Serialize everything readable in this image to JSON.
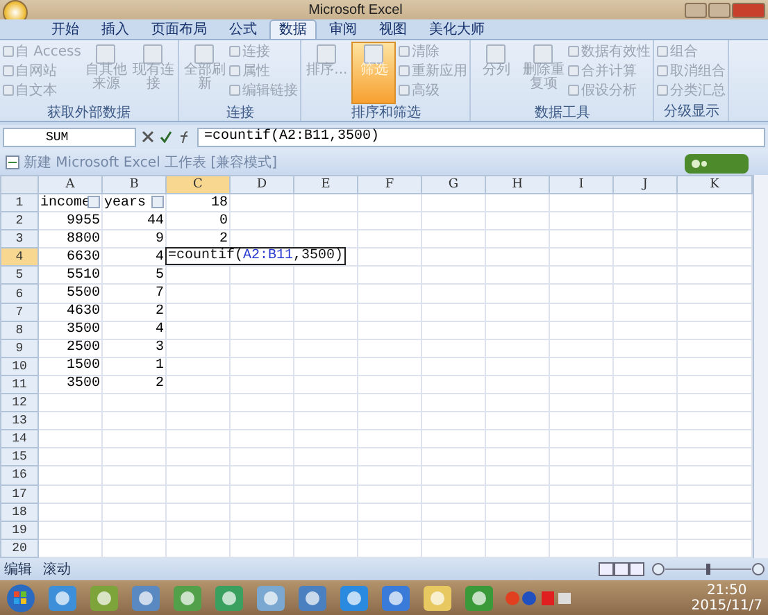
{
  "window": {
    "title": "Microsoft Excel"
  },
  "tabs": [
    {
      "label": "开始",
      "selected": false
    },
    {
      "label": "插入",
      "selected": false
    },
    {
      "label": "页面布局",
      "selected": false
    },
    {
      "label": "公式",
      "selected": false
    },
    {
      "label": "数据",
      "selected": true
    },
    {
      "label": "审阅",
      "selected": false
    },
    {
      "label": "视图",
      "selected": false
    },
    {
      "label": "美化大师",
      "selected": false
    }
  ],
  "ribbon": {
    "groups": [
      {
        "title": "获取外部数据",
        "columns": [
          [
            {
              "label": "自 Access",
              "kind": "small",
              "disabled": true,
              "active": false
            },
            {
              "label": "自网站",
              "kind": "small",
              "disabled": true,
              "active": false
            },
            {
              "label": "自文本",
              "kind": "small",
              "disabled": true,
              "active": false
            }
          ],
          [
            {
              "label": "自其他来源",
              "kind": "large",
              "disabled": true,
              "active": false
            }
          ],
          [
            {
              "label": "现有连接",
              "kind": "large",
              "disabled": true,
              "active": false
            }
          ]
        ]
      },
      {
        "title": "连接",
        "columns": [
          [
            {
              "label": "全部刷新",
              "kind": "large",
              "disabled": true,
              "active": false
            }
          ],
          [
            {
              "label": "连接",
              "kind": "small",
              "disabled": true,
              "active": false
            },
            {
              "label": "属性",
              "kind": "small",
              "disabled": true,
              "active": false
            },
            {
              "label": "编辑链接",
              "kind": "small",
              "disabled": true,
              "active": false
            }
          ]
        ]
      },
      {
        "title": "排序和筛选",
        "columns": [
          [
            {
              "label": "排序...",
              "kind": "large",
              "disabled": true,
              "active": false
            }
          ],
          [
            {
              "label": "筛选",
              "kind": "large",
              "disabled": true,
              "active": true
            }
          ],
          [
            {
              "label": "清除",
              "kind": "small",
              "disabled": true,
              "active": false
            },
            {
              "label": "重新应用",
              "kind": "small",
              "disabled": true,
              "active": false
            },
            {
              "label": "高级",
              "kind": "small",
              "disabled": true,
              "active": false
            }
          ]
        ]
      },
      {
        "title": "数据工具",
        "columns": [
          [
            {
              "label": "分列",
              "kind": "large",
              "disabled": true,
              "active": false
            }
          ],
          [
            {
              "label": "删除重复项",
              "kind": "large",
              "disabled": true,
              "active": false
            }
          ],
          [
            {
              "label": "数据有效性",
              "kind": "small",
              "disabled": true,
              "active": false
            },
            {
              "label": "合并计算",
              "kind": "small",
              "disabled": true,
              "active": false
            },
            {
              "label": "假设分析",
              "kind": "small",
              "disabled": true,
              "active": false
            }
          ]
        ]
      },
      {
        "title": "分级显示",
        "columns": [
          [
            {
              "label": "组合",
              "kind": "small",
              "disabled": true,
              "active": false
            },
            {
              "label": "取消组合",
              "kind": "small",
              "disabled": true,
              "active": false
            },
            {
              "label": "分类汇总",
              "kind": "small",
              "disabled": true,
              "active": false
            }
          ]
        ]
      }
    ]
  },
  "formula_bar": {
    "name_box": "SUM",
    "formula": "=countif(A2:B11,3500)"
  },
  "workbook": {
    "title": "新建 Microsoft Excel 工作表 [兼容模式]"
  },
  "sheet": {
    "columns": [
      {
        "label": "A",
        "selected": false
      },
      {
        "label": "B",
        "selected": false
      },
      {
        "label": "C",
        "selected": true
      },
      {
        "label": "D",
        "selected": false
      },
      {
        "label": "E",
        "selected": false
      },
      {
        "label": "F",
        "selected": false
      },
      {
        "label": "G",
        "selected": false
      },
      {
        "label": "H",
        "selected": false
      },
      {
        "label": "I",
        "selected": false
      },
      {
        "label": "J",
        "selected": false
      },
      {
        "label": "K",
        "selected": false
      }
    ],
    "rows": [
      {
        "number": "1",
        "selected": false,
        "cells": [
          {
            "text": "income",
            "filter": true
          },
          {
            "text": "years",
            "filter": true
          },
          {
            "text": "18",
            "filter": false
          }
        ]
      },
      {
        "number": "2",
        "selected": false,
        "cells": [
          "9955",
          "44",
          "0"
        ]
      },
      {
        "number": "3",
        "selected": false,
        "cells": [
          "8800",
          "9",
          "2"
        ]
      },
      {
        "number": "4",
        "selected": true,
        "cells": [
          "6630",
          "4"
        ],
        "editing": [
          {
            "text": "=countif(",
            "ref": false
          },
          {
            "text": "A2:B11",
            "ref": true
          },
          {
            "text": ",3500)",
            "ref": false
          }
        ]
      },
      {
        "number": "5",
        "selected": false,
        "cells": [
          "5510",
          "5"
        ]
      },
      {
        "number": "6",
        "selected": false,
        "cells": [
          "5500",
          "7"
        ]
      },
      {
        "number": "7",
        "selected": false,
        "cells": [
          "4630",
          "2"
        ]
      },
      {
        "number": "8",
        "selected": false,
        "cells": [
          "3500",
          "4"
        ]
      },
      {
        "number": "9",
        "selected": false,
        "cells": [
          "2500",
          "3"
        ]
      },
      {
        "number": "10",
        "selected": false,
        "cells": [
          "1500",
          "1"
        ]
      },
      {
        "number": "11",
        "selected": false,
        "cells": [
          "3500",
          "2"
        ]
      },
      {
        "number": "12",
        "selected": false,
        "cells": []
      },
      {
        "number": "13",
        "selected": false,
        "cells": []
      },
      {
        "number": "14",
        "selected": false,
        "cells": []
      },
      {
        "number": "15",
        "selected": false,
        "cells": []
      },
      {
        "number": "16",
        "selected": false,
        "cells": []
      },
      {
        "number": "17",
        "selected": false,
        "cells": []
      },
      {
        "number": "18",
        "selected": false,
        "cells": []
      },
      {
        "number": "19",
        "selected": false,
        "cells": []
      },
      {
        "number": "20",
        "selected": false,
        "cells": []
      }
    ]
  },
  "status_bar": {
    "items": [
      "编辑",
      "滚动"
    ],
    "zoom": {
      "level": 0.5
    }
  },
  "taskbar": {
    "time": "21:50",
    "date": "2015/11/7"
  }
}
